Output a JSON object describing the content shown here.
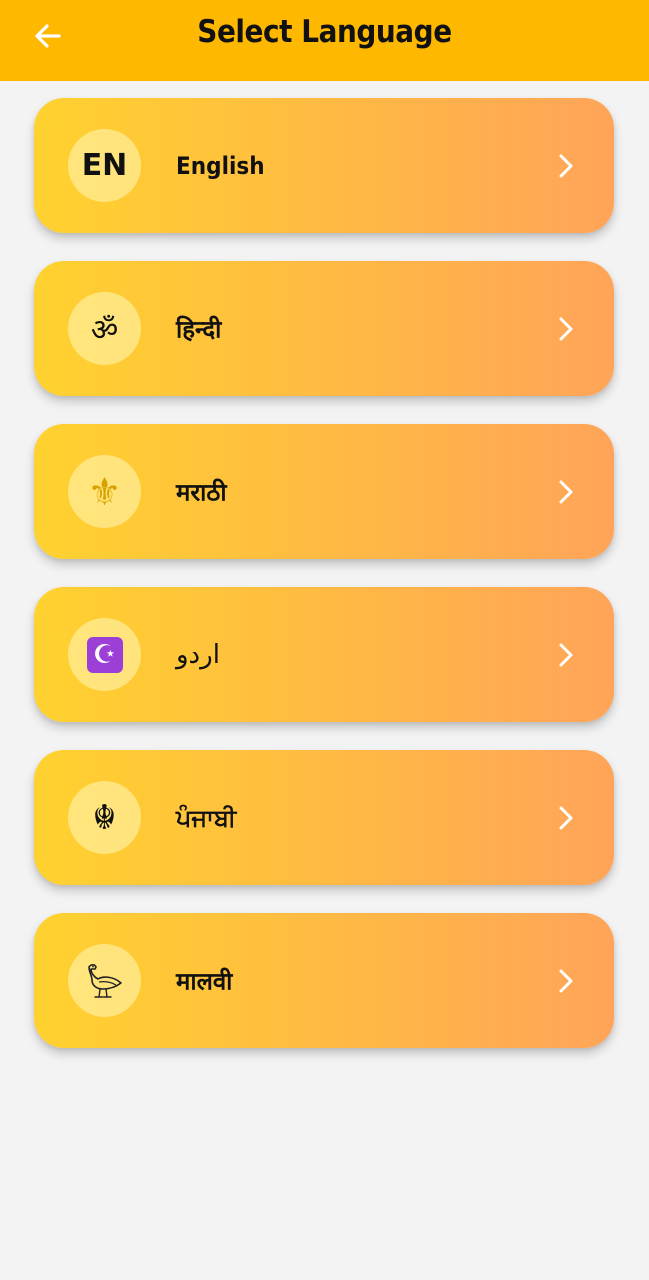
{
  "header": {
    "title": "Select Language",
    "background": "#ffb800",
    "back_icon": "arrow-left-icon"
  },
  "languages": [
    {
      "label": "English",
      "badge": "EN",
      "icon": "en-text-badge"
    },
    {
      "label": "हिन्दी",
      "badge": "ॐ",
      "icon": "om-icon"
    },
    {
      "label": "मराठी",
      "badge": "⚜",
      "icon": "fleur-de-lis-icon"
    },
    {
      "label": "اردو",
      "badge": "☪",
      "icon": "crescent-star-icon"
    },
    {
      "label": "ਪੰਜਾਬੀ",
      "badge": "☬",
      "icon": "khanda-icon"
    },
    {
      "label": "मालवी",
      "badge": "",
      "icon": "bird-icon"
    }
  ],
  "colors": {
    "card_gradient_start": "#ffd22f",
    "card_gradient_end": "#ffa459",
    "background": "#f3f3f3",
    "chevron": "#ffffff"
  }
}
